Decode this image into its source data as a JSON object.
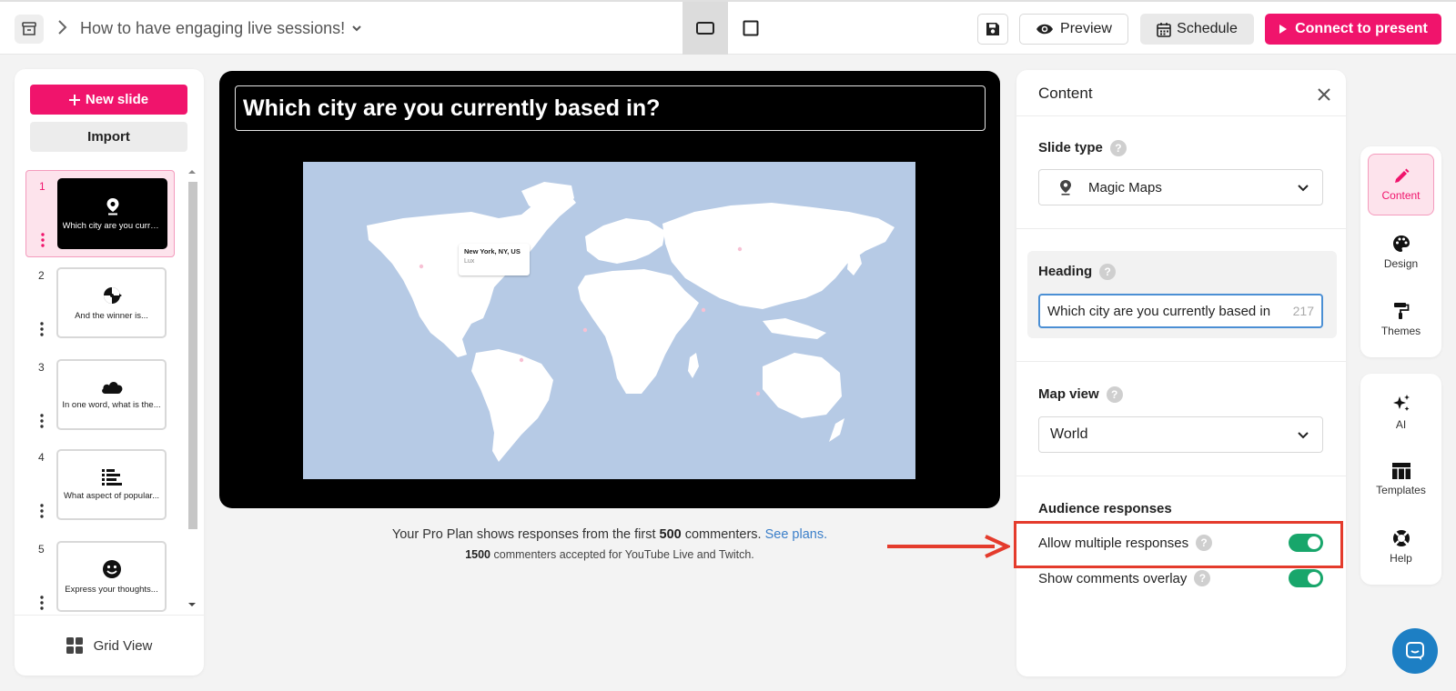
{
  "header": {
    "presentation_title": "How to have engaging live sessions!",
    "preview_label": "Preview",
    "schedule_label": "Schedule",
    "connect_label": "Connect to present"
  },
  "sidebar": {
    "new_slide_label": "New slide",
    "import_label": "Import",
    "grid_view_label": "Grid View",
    "slides": [
      {
        "number": "1",
        "text": "Which city are you currently based in?",
        "icon": "map-pin-icon",
        "active": true
      },
      {
        "number": "2",
        "text": "And the winner is...",
        "icon": "spinner-wheel-icon"
      },
      {
        "number": "3",
        "text": "In one word, what is the...",
        "icon": "cloud-icon"
      },
      {
        "number": "4",
        "text": "What aspect of popular...",
        "icon": "bar-list-icon"
      },
      {
        "number": "5",
        "text": "Express your thoughts...",
        "icon": "smiley-icon"
      }
    ]
  },
  "canvas": {
    "heading": "Which city are you currently based in?",
    "tooltip": {
      "city": "New York, NY, US",
      "name": "Lux"
    }
  },
  "plan_note": {
    "prefix": "Your Pro Plan shows responses from the first ",
    "count": "500",
    "suffix": " commenters. ",
    "link": "See plans.",
    "line2_count": "1500",
    "line2_text": " commenters accepted for YouTube Live and Twitch."
  },
  "content_panel": {
    "title": "Content",
    "slide_type_label": "Slide type",
    "slide_type_value": "Magic Maps",
    "heading_label": "Heading",
    "heading_value": "Which city are you currently based in",
    "heading_chars_left": "217",
    "map_view_label": "Map view",
    "map_view_value": "World",
    "audience_label": "Audience responses",
    "allow_multiple_label": "Allow multiple responses",
    "allow_multiple_on": true,
    "show_comments_label": "Show comments overlay",
    "show_comments_on": true
  },
  "rail": {
    "content": "Content",
    "design": "Design",
    "themes": "Themes",
    "ai": "AI",
    "templates": "Templates",
    "help": "Help"
  },
  "colors": {
    "accent": "#f0146c",
    "toggle_on": "#18a66b",
    "annotation": "#e43b2c",
    "map_water": "#b6cae5"
  }
}
